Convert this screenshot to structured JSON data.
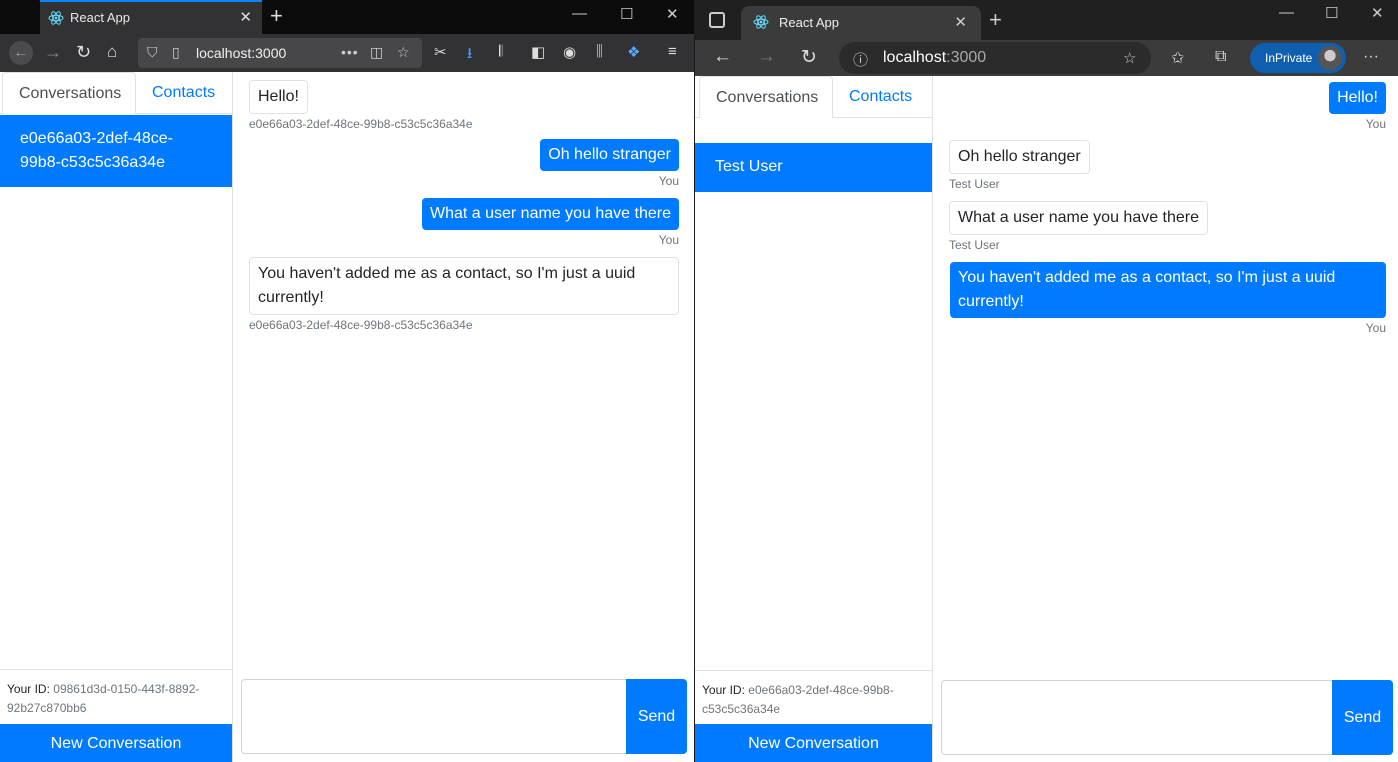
{
  "left_browser": {
    "tab_title": "React App",
    "url": "localhost:3000",
    "app": {
      "tabs": [
        "Conversations",
        "Contacts"
      ],
      "conversation_item": "e0e66a03-2def-48ce-99b8-c53c5c36a34e",
      "your_id_label": "Your ID:",
      "your_id_value": "09861d3d-0150-443f-8892-92b27c870bb6",
      "new_conversation": "New Conversation",
      "messages": [
        {
          "text": "Hello!",
          "sender": "e0e66a03-2def-48ce-99b8-c53c5c36a34e",
          "from_me": false
        },
        {
          "text": "Oh hello stranger",
          "sender": "You",
          "from_me": true
        },
        {
          "text": "What a user name you have there",
          "sender": "You",
          "from_me": true
        },
        {
          "text": "You haven't added me as a contact, so I'm just a uuid currently!",
          "sender": "e0e66a03-2def-48ce-99b8-c53c5c36a34e",
          "from_me": false
        }
      ],
      "send": "Send",
      "message_value": ""
    }
  },
  "right_browser": {
    "tab_title": "React App",
    "url_host": "localhost",
    "url_port": ":3000",
    "inprivate": "InPrivate",
    "app": {
      "tabs": [
        "Conversations",
        "Contacts"
      ],
      "conversation_item": "Test User",
      "your_id_label": "Your ID:",
      "your_id_value": "e0e66a03-2def-48ce-99b8-c53c5c36a34e",
      "new_conversation": "New Conversation",
      "messages": [
        {
          "text": "Hello!",
          "sender": "You",
          "from_me": true
        },
        {
          "text": "Oh hello stranger",
          "sender": "Test User",
          "from_me": false
        },
        {
          "text": "What a user name you have there",
          "sender": "Test User",
          "from_me": false
        },
        {
          "text": "You haven't added me as a contact, so I'm just a uuid currently!",
          "sender": "You",
          "from_me": true
        }
      ],
      "send": "Send",
      "message_value": ""
    }
  },
  "colors": {
    "primary": "#007bff",
    "firefox_dark": "#0c0c0d",
    "edge_dark": "#202020"
  }
}
